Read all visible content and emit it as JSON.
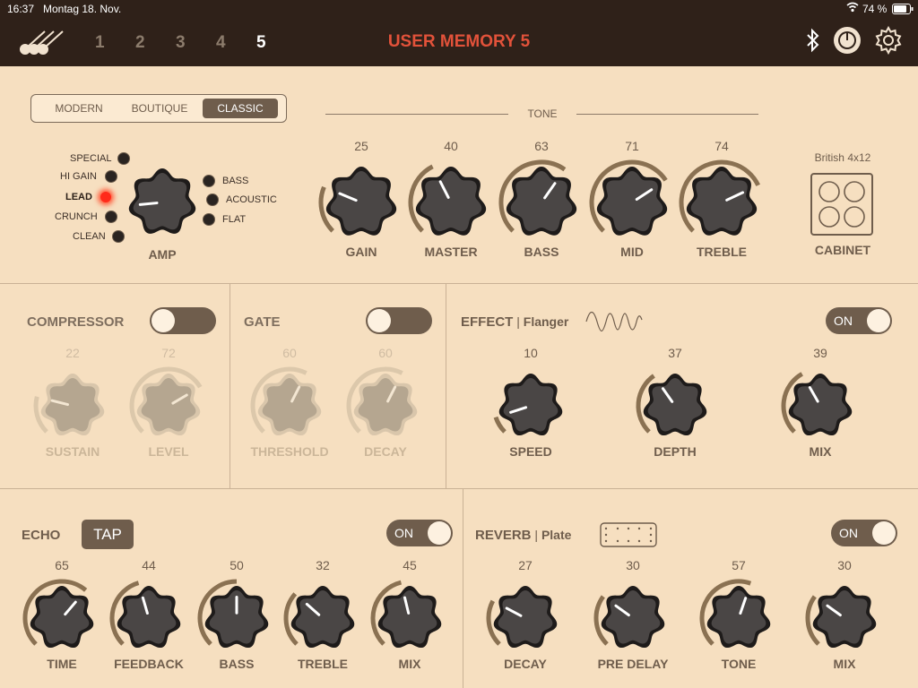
{
  "status": {
    "time": "16:37",
    "date": "Montag 18. Nov.",
    "battery": "74 %"
  },
  "header": {
    "title": "USER MEMORY 5",
    "memories": [
      "1",
      "2",
      "3",
      "4",
      "5"
    ],
    "active_memory": "5"
  },
  "amp": {
    "types": [
      "MODERN",
      "BOUTIQUE",
      "CLASSIC"
    ],
    "selected_type": "CLASSIC",
    "tone_label": "TONE",
    "channels": [
      "SPECIAL",
      "HI GAIN",
      "LEAD",
      "CRUNCH",
      "CLEAN"
    ],
    "active_channel": "LEAD",
    "eq_modes": [
      "BASS",
      "ACOUSTIC",
      "FLAT"
    ],
    "amp_label": "AMP",
    "knobs": [
      {
        "label": "GAIN",
        "value": "25"
      },
      {
        "label": "MASTER",
        "value": "40"
      },
      {
        "label": "BASS",
        "value": "63"
      },
      {
        "label": "MID",
        "value": "71"
      },
      {
        "label": "TREBLE",
        "value": "74"
      }
    ],
    "cabinet": {
      "name": "British 4x12",
      "label": "CABINET"
    }
  },
  "compressor": {
    "title": "COMPRESSOR",
    "on": true,
    "knobs": [
      {
        "label": "SUSTAIN",
        "value": "22"
      },
      {
        "label": "LEVEL",
        "value": "72"
      }
    ]
  },
  "gate": {
    "title": "GATE",
    "on": true,
    "knobs": [
      {
        "label": "THRESHOLD",
        "value": "60"
      },
      {
        "label": "DECAY",
        "value": "60"
      }
    ]
  },
  "effect": {
    "title": "EFFECT",
    "type": "Flanger",
    "toggle": "ON",
    "knobs": [
      {
        "label": "SPEED",
        "value": "10"
      },
      {
        "label": "DEPTH",
        "value": "37"
      },
      {
        "label": "MIX",
        "value": "39"
      }
    ]
  },
  "echo": {
    "title": "ECHO",
    "tap": "TAP",
    "toggle": "ON",
    "knobs": [
      {
        "label": "TIME",
        "value": "65"
      },
      {
        "label": "FEEDBACK",
        "value": "44"
      },
      {
        "label": "BASS",
        "value": "50"
      },
      {
        "label": "TREBLE",
        "value": "32"
      },
      {
        "label": "MIX",
        "value": "45"
      }
    ]
  },
  "reverb": {
    "title": "REVERB",
    "type": "Plate",
    "toggle": "ON",
    "knobs": [
      {
        "label": "DECAY",
        "value": "27"
      },
      {
        "label": "PRE DELAY",
        "value": "30"
      },
      {
        "label": "TONE",
        "value": "57"
      },
      {
        "label": "MIX",
        "value": "30"
      }
    ]
  },
  "colors": {
    "background": "#f6dfc0",
    "header": "#2f2119",
    "accent": "#e2523a",
    "control": "#6f5d4c",
    "knob": "#4a4645"
  },
  "icons": [
    "guitars-logo-icon",
    "bluetooth-icon",
    "tuner-knob-icon",
    "gear-icon",
    "wifi-icon",
    "battery-icon",
    "wave-icon",
    "plate-icon"
  ]
}
